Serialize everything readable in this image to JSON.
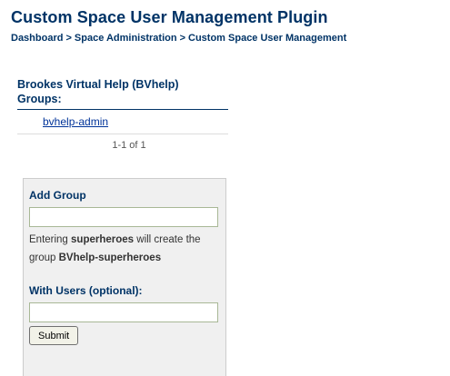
{
  "header": {
    "title": "Custom Space User Management Plugin",
    "breadcrumb": {
      "dashboard": "Dashboard",
      "separator": ">",
      "space_admin": "Space Administration",
      "current": "Custom Space User Management"
    }
  },
  "groups": {
    "heading_line1": "Brookes Virtual Help (BVhelp)",
    "heading_line2": "Groups:",
    "items": [
      {
        "label": "bvhelp-admin"
      }
    ],
    "pager": "1-1 of 1"
  },
  "add_group": {
    "heading": "Add Group",
    "name_value": "",
    "help_prefix": "Entering ",
    "help_example": "superheroes",
    "help_middle": " will create the group ",
    "help_group_prefix": "BVhelp-",
    "help_group_suffix": "superheroes",
    "users_heading": "With Users (optional):",
    "users_value": "",
    "submit_label": "Submit"
  },
  "colors": {
    "heading": "#003366",
    "link": "#003399",
    "panel_bg": "#f0f0f0",
    "input_border": "#a8b896"
  }
}
